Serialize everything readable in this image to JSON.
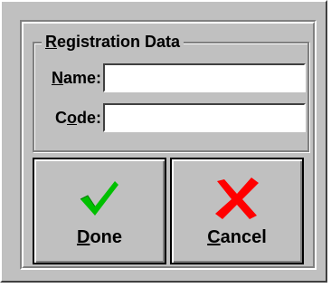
{
  "dialog": {
    "group_title": "Registration Data",
    "name_label": "Name:",
    "code_label": "Code:",
    "name_value": "",
    "code_value": "",
    "done_label": "Done",
    "cancel_label": "Cancel",
    "done_icon": "checkmark-icon",
    "cancel_icon": "x-icon",
    "colors": {
      "face": "#c0c0c0",
      "check": "#00c000",
      "x": "#ff0000"
    }
  }
}
